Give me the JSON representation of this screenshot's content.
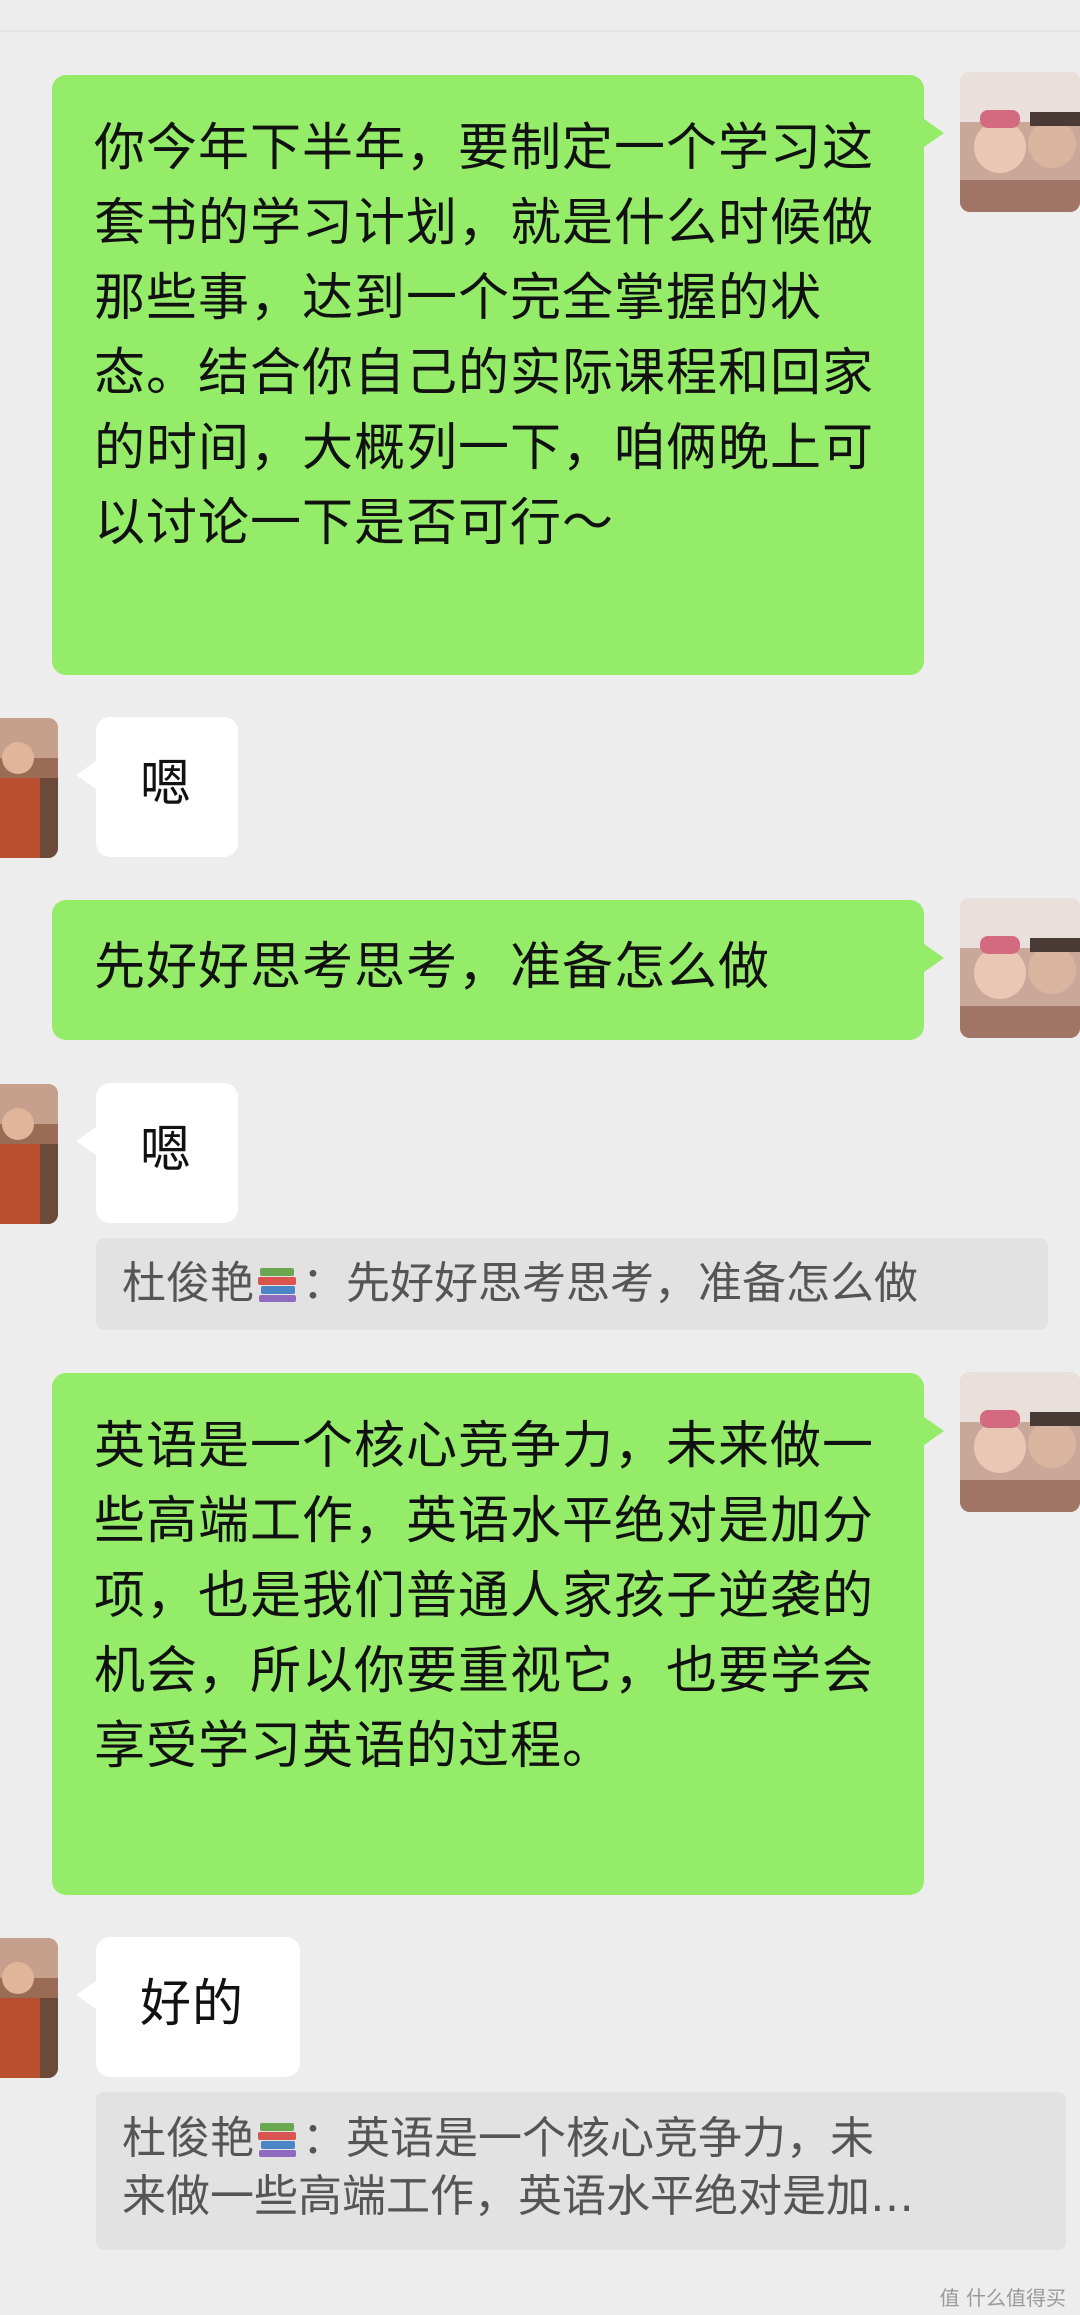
{
  "messages": [
    {
      "sender": "me",
      "text": "你今年下半年，要制定一个学习这套书的学习计划，就是什么时候做那些事，达到一个完全掌握的状态。结合你自己的实际课程和回家的时间，大概列一下，咱俩晚上可以讨论一下是否可行～"
    },
    {
      "sender": "other",
      "text": "嗯"
    },
    {
      "sender": "me",
      "text": "先好好思考思考，准备怎么做"
    },
    {
      "sender": "other",
      "text": "嗯",
      "quote": {
        "name": "杜俊艳",
        "icon": "books-icon",
        "text": "：先好好思考思考，准备怎么做"
      }
    },
    {
      "sender": "me",
      "text": "英语是一个核心竞争力，未来做一些高端工作，英语水平绝对是加分项，也是我们普通人家孩子逆袭的机会，所以你要重视它，也要学会享受学习英语的过程。"
    },
    {
      "sender": "other",
      "text": "好的",
      "quote": {
        "name": "杜俊艳",
        "icon": "books-icon",
        "line1": "：英语是一个核心竞争力，未",
        "line2": "来做一些高端工作，英语水平绝对是加…"
      }
    }
  ],
  "watermark": "值 什么值得买",
  "colors": {
    "background": "#ededed",
    "my_bubble": "#95ec69",
    "other_bubble": "#ffffff",
    "quote_bg": "#e2e2e2"
  }
}
